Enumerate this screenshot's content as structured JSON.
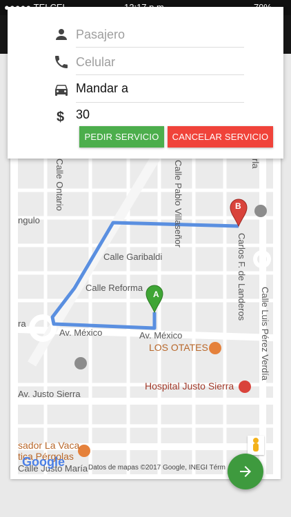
{
  "status_bar": {
    "carrier": "●●●●● TELCEL",
    "time": "12:17 p.m.",
    "battery": "79%"
  },
  "form": {
    "passenger": {
      "placeholder": "Pasajero",
      "icon": "person-icon"
    },
    "phone": {
      "placeholder": "Celular",
      "icon": "phone-icon"
    },
    "send_to": {
      "value": "Mandar a",
      "icon": "car-icon"
    },
    "price": {
      "value": "30",
      "icon": "dollar-icon"
    },
    "request_button": "PEDIR SERVICIO",
    "cancel_button": "CANCELAR SERVICIO"
  },
  "map": {
    "streets": {
      "ontario": "Calle Ontario",
      "pablo_villasenor": "Calle Pablo Villaseñor",
      "carlos_landeros": "Carlos F. de Landeros",
      "luis_perez_verdia": "Calle Luis Pérez Verdía",
      "garibaldi": "Calle Garibaldi",
      "reforma": "Calle Reforma",
      "av_mexico_left": "Av. México",
      "av_mexico_right": "Av. México",
      "justo_sierra": "Av. Justo Sierra",
      "angulo": "ngulo",
      "calle_maria": "Calle Justo María",
      "ra": "ra",
      "rla": "rla"
    },
    "pois": {
      "los_otates": "LOS OTATES",
      "hospital": "Hospital Justo Sierra",
      "la_vaca": "sador La Vaca",
      "pergolas": "tica Pérgolas"
    },
    "markers": {
      "a": "A",
      "b": "B"
    },
    "google": "Google",
    "attribution": "Datos de mapas ©2017 Google, INEGI   Térm",
    "route_color": "#5a8fe0",
    "marker_a_color": "#3fa535",
    "marker_b_color": "#d9433b"
  },
  "colors": {
    "green": "#4cae4c",
    "red": "#f0433a",
    "fab": "#3e9a3e"
  }
}
